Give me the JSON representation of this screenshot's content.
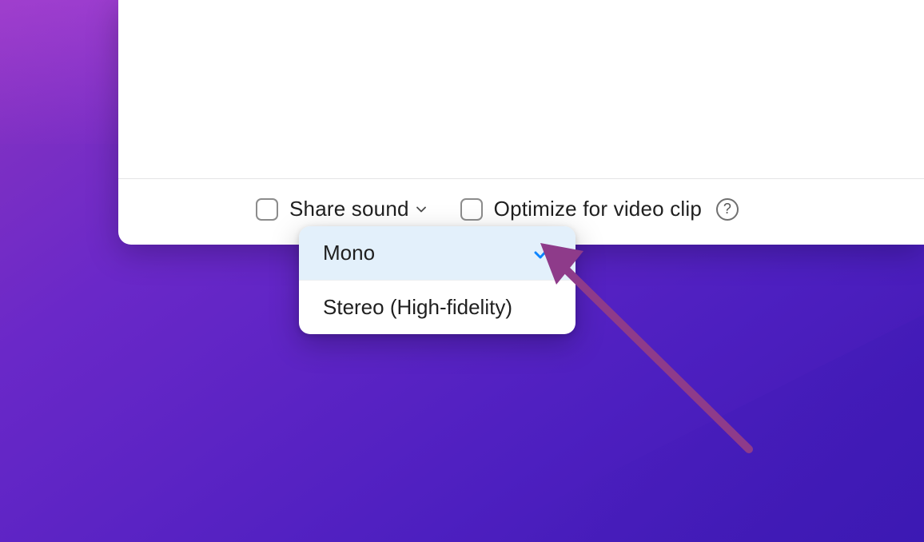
{
  "footer": {
    "share_sound_label": "Share sound",
    "optimize_label": "Optimize for video clip"
  },
  "dropdown": {
    "items": [
      {
        "label": "Mono",
        "selected": true
      },
      {
        "label": "Stereo (High-fidelity)",
        "selected": false
      }
    ]
  },
  "colors": {
    "highlight": "#e3f0fb",
    "check": "#0b84ff",
    "annotation_arrow": "#8e3b8a"
  }
}
